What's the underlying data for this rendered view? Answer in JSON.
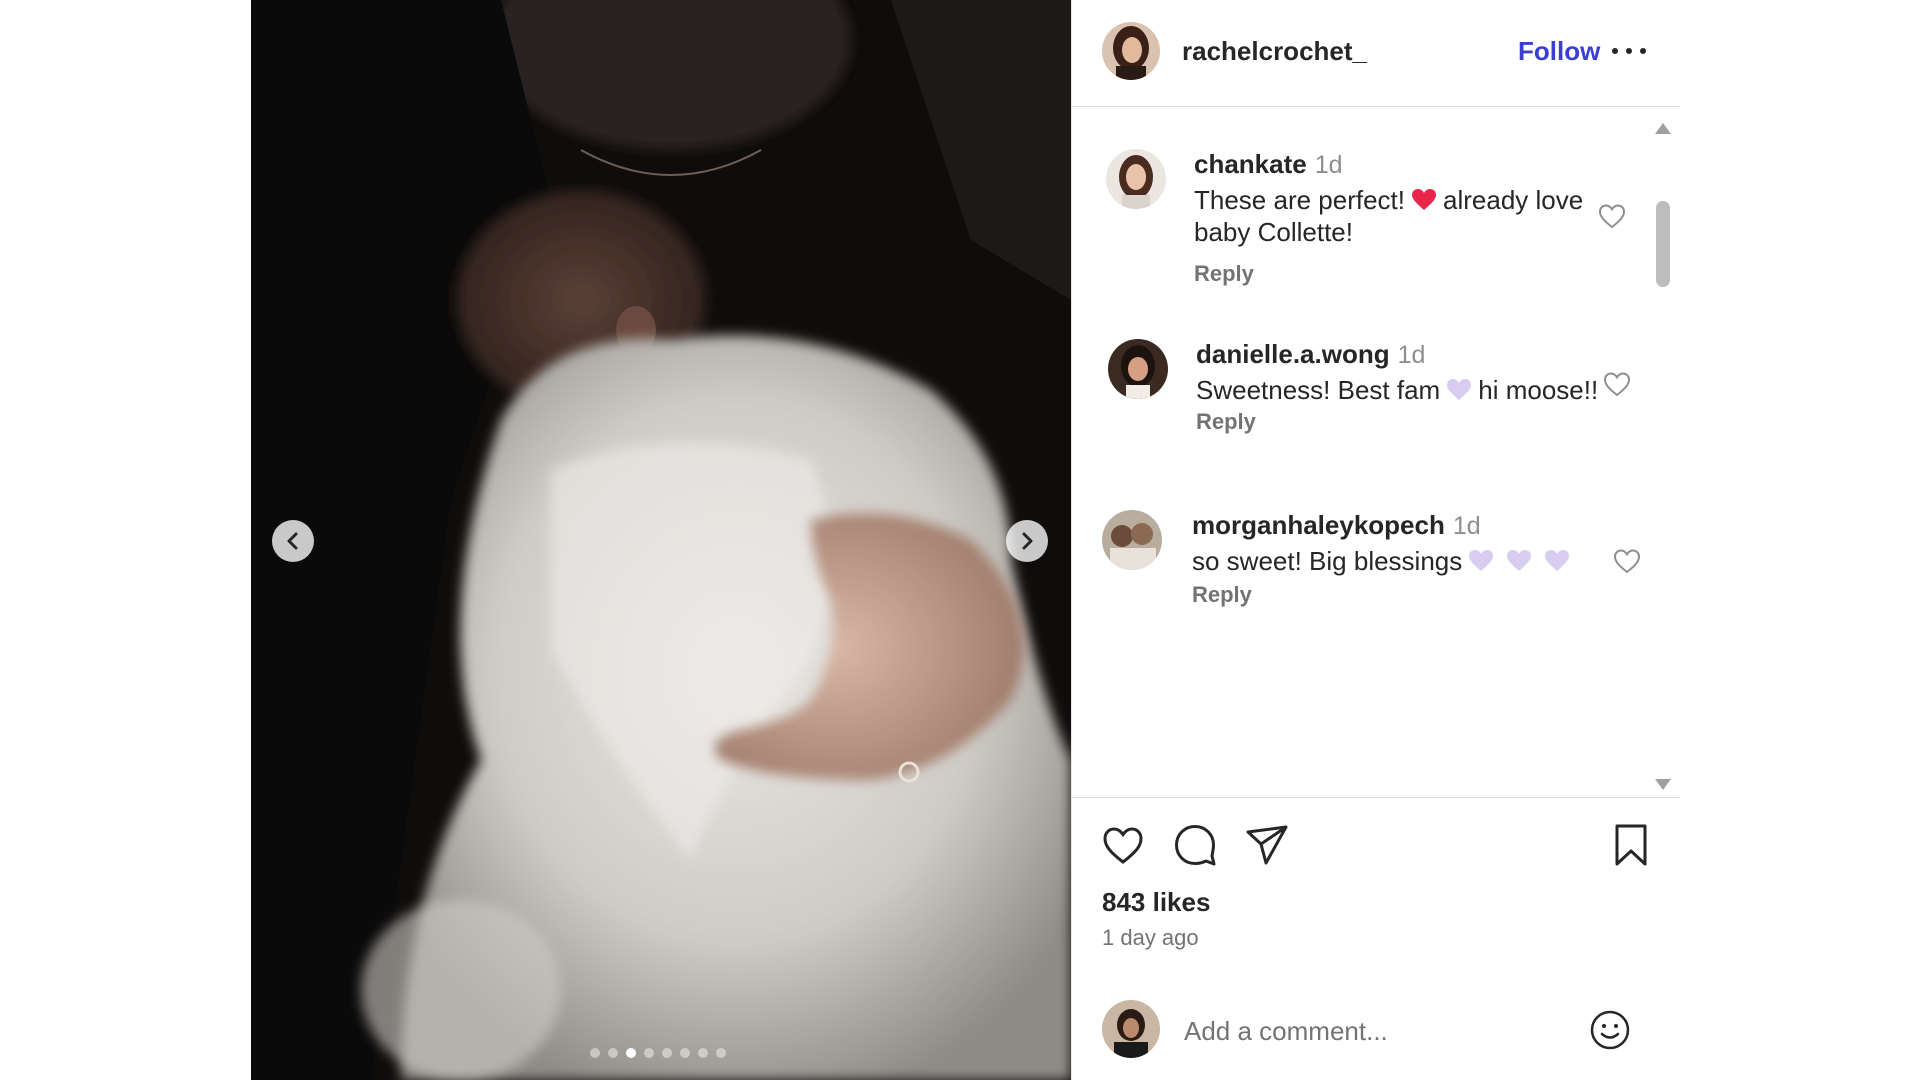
{
  "post": {
    "author": "rachelcrochet_",
    "follow_label": "Follow",
    "likes": "843 likes",
    "time_ago": "1 day ago",
    "carousel_total": 8,
    "carousel_active_index": 2
  },
  "comments": [
    {
      "user": "chankate",
      "time": "1d",
      "text_before": "These are perfect!",
      "emoji": "red-heart",
      "text_after": "already love baby Collette!",
      "reply_label": "Reply"
    },
    {
      "user": "danielle.a.wong",
      "time": "1d",
      "text_before": "Sweetness! Best fam",
      "emoji": "lavender-heart",
      "text_after": "hi moose!!",
      "reply_label": "Reply"
    },
    {
      "user": "morganhaleykopech",
      "time": "1d",
      "text_before": "so sweet! Big blessings",
      "emoji": "lavender-heart x3",
      "text_after": "",
      "reply_label": "Reply"
    }
  ],
  "add_comment": {
    "placeholder": "Add a comment..."
  },
  "colors": {
    "follow_blue": "#3b3fd1",
    "red_heart": "#e8264b",
    "lavender_heart": "#d8ccf0"
  }
}
